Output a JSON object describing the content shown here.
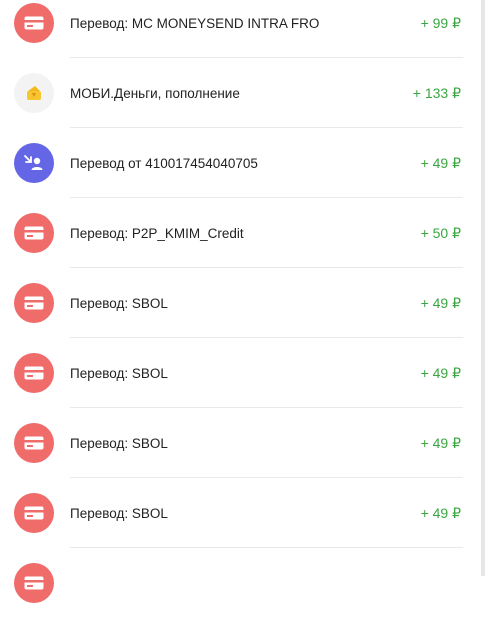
{
  "colors": {
    "amount_green": "#3aa642",
    "card_icon_bg": "#ef6c6a",
    "transfer_icon_bg": "#6466e6",
    "wallet_icon_bg": "#f3f3f3"
  },
  "transactions": [
    {
      "icon": "card-icon",
      "title": "Перевод: MC MONEYSEND INTRA FRO",
      "amount": "+ 99 ₽"
    },
    {
      "icon": "wallet-icon",
      "title": "МОБИ.Деньги, пополнение",
      "amount": "+ 133 ₽"
    },
    {
      "icon": "incoming-transfer-icon",
      "title": "Перевод от 410017454040705",
      "amount": "+ 49 ₽"
    },
    {
      "icon": "card-icon",
      "title": "Перевод: P2P_KMIM_Credit",
      "amount": "+ 50 ₽"
    },
    {
      "icon": "card-icon",
      "title": "Перевод: SBOL",
      "amount": "+ 49 ₽"
    },
    {
      "icon": "card-icon",
      "title": "Перевод: SBOL",
      "amount": "+ 49 ₽"
    },
    {
      "icon": "card-icon",
      "title": "Перевод: SBOL",
      "amount": "+ 49 ₽"
    },
    {
      "icon": "card-icon",
      "title": "Перевод: SBOL",
      "amount": "+ 49 ₽"
    },
    {
      "icon": "card-icon",
      "title": "",
      "amount": ""
    }
  ]
}
